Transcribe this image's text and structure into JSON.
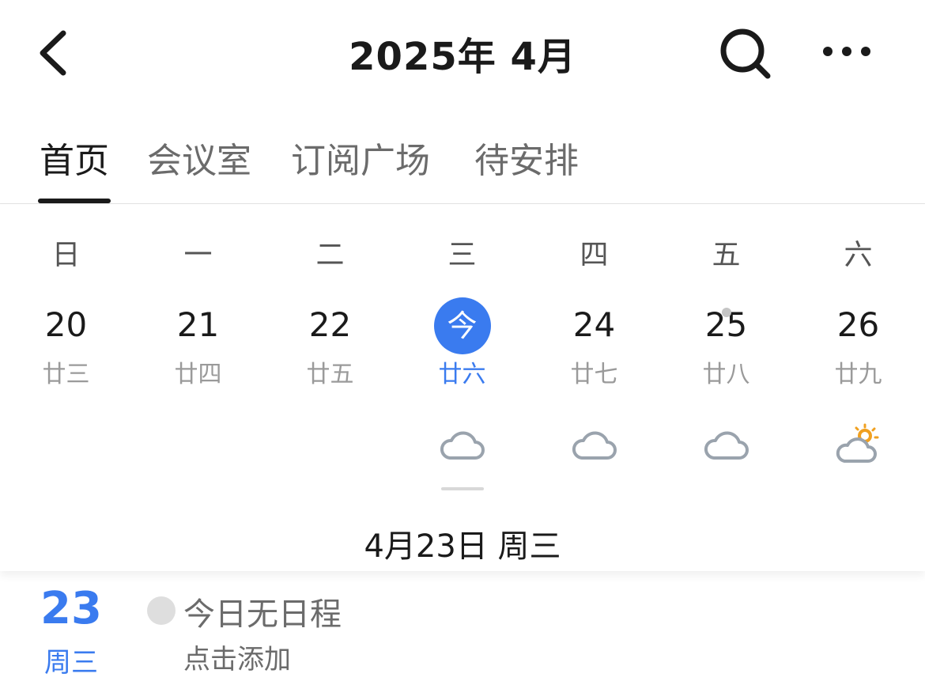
{
  "header": {
    "title": "2025年 4月",
    "back_icon": "chevron-left-icon",
    "search_icon": "search-icon",
    "more_icon": "more-horizontal-icon"
  },
  "tabs": [
    {
      "label": "首页",
      "active": true
    },
    {
      "label": "会议室",
      "active": false
    },
    {
      "label": "订阅广场",
      "active": false
    },
    {
      "label": "待安排",
      "active": false
    }
  ],
  "calendar": {
    "weekdays": [
      "日",
      "一",
      "二",
      "三",
      "四",
      "五",
      "六"
    ],
    "days": [
      {
        "day": "20",
        "lunar": "廿三"
      },
      {
        "day": "21",
        "lunar": "廿四"
      },
      {
        "day": "22",
        "lunar": "廿五"
      },
      {
        "day": "23",
        "today_label": "今",
        "lunar": "廿六",
        "is_today": true,
        "weather": "cloudy-icon"
      },
      {
        "day": "24",
        "lunar": "廿七",
        "weather": "cloudy-icon"
      },
      {
        "day": "25",
        "lunar": "廿八",
        "has_event": true,
        "weather": "cloudy-icon"
      },
      {
        "day": "26",
        "lunar": "廿九",
        "weather": "partly-sunny-icon"
      }
    ],
    "selected_date": "4月23日 周三"
  },
  "agenda": {
    "day": "23",
    "weekday": "周三",
    "empty_text": "今日无日程",
    "add_text": "点击添加"
  },
  "colors": {
    "accent": "#3a7bef",
    "text": "#1a1a1a",
    "muted": "#6b6b6b",
    "sun": "#f0a020",
    "cloud_stroke": "#9aa3ad"
  }
}
